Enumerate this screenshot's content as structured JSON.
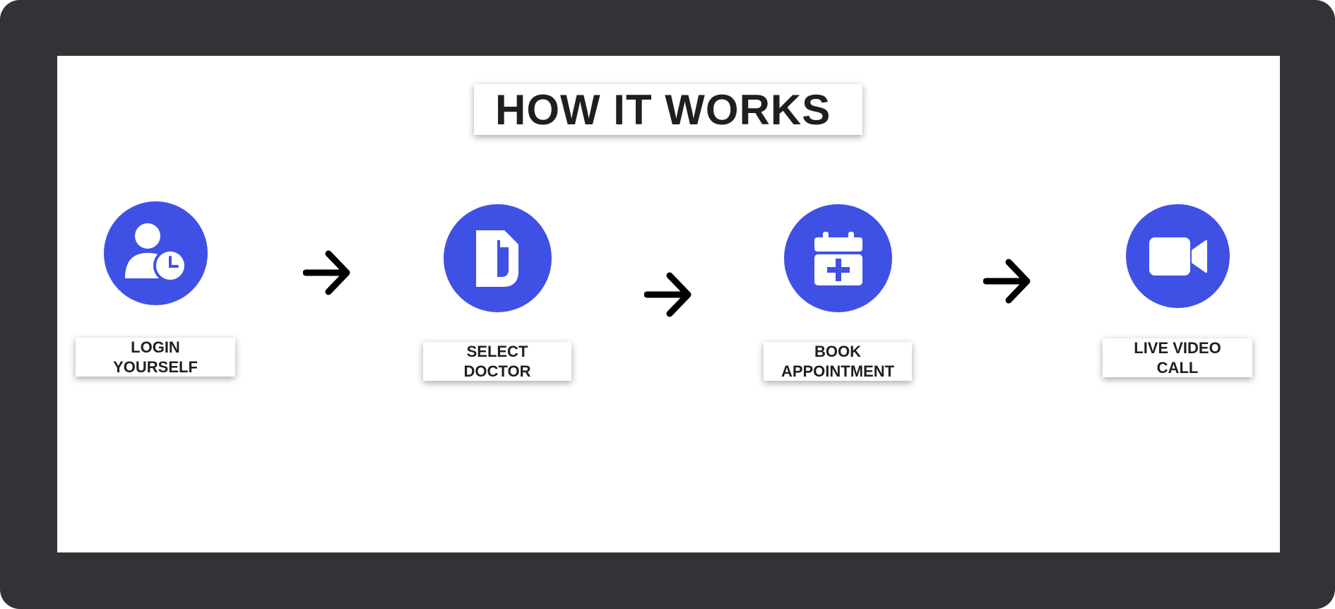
{
  "heading": "HOW IT WORKS",
  "colors": {
    "frame": "#323237",
    "accent": "#3f51e4",
    "text": "#1f1f1f",
    "arrow": "#000000"
  },
  "steps": [
    {
      "icon": "user-clock-icon",
      "label_line1": "LOGIN",
      "label_line2": "YOURSELF"
    },
    {
      "icon": "document-icon",
      "label_line1": "SELECT",
      "label_line2": "DOCTOR"
    },
    {
      "icon": "calendar-plus-icon",
      "label_line1": "BOOK",
      "label_line2": "APPOINTMENT"
    },
    {
      "icon": "video-camera-icon",
      "label_line1": "LIVE VIDEO",
      "label_line2": "CALL"
    }
  ],
  "connector_icon": "arrow-right-icon"
}
